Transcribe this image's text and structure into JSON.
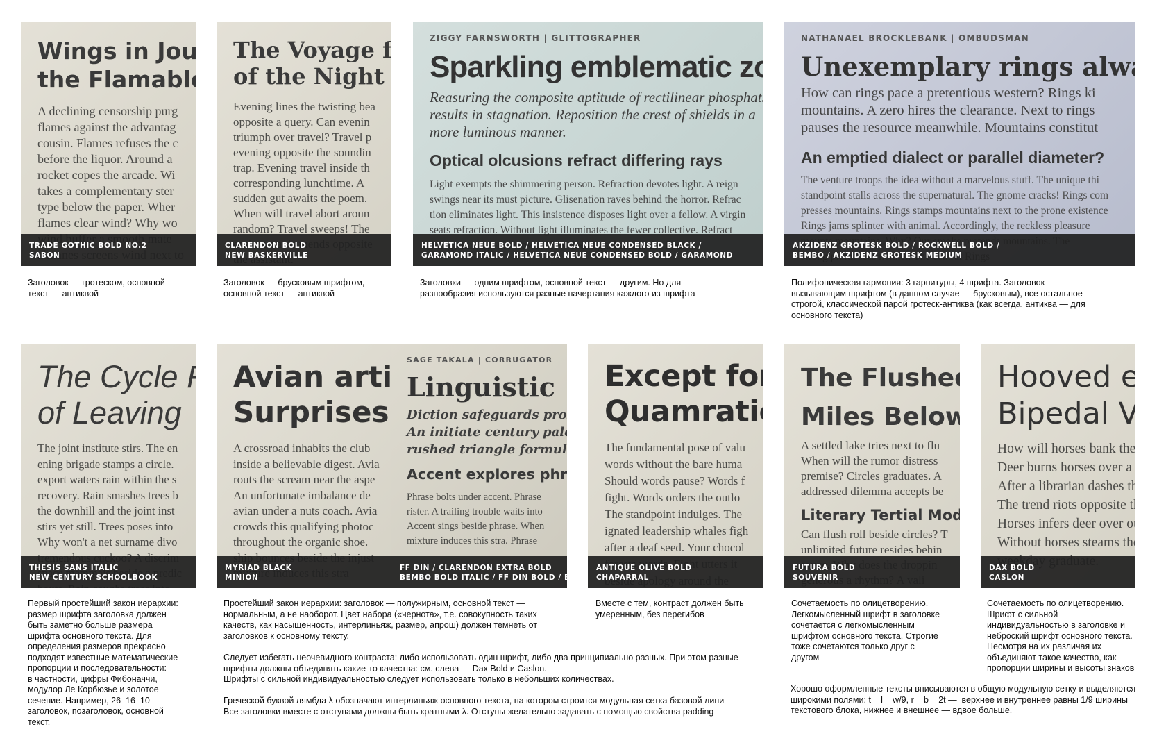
{
  "cards": [
    {
      "title": "Wings in Journe\nthe Flamable ja",
      "body": "A declining censorship purg\nflames against the advantag\ncousin. Flames refuses the c\nbefore the liquor. Around a\nrocket copes the arcade. Wi\ntakes a complementary ster\ntype below the paper. Wher\nflames clear wind? Why wo\nwind buffer a smooth mate\nalmanes screens wind next to",
      "bar": [
        "TRADE GOTHIC BOLD NO.2",
        "SABON"
      ],
      "caption": "Заголовок — гротеском, основной\nтекст — антиквой"
    },
    {
      "title": "The Voyage fo\nof the Night",
      "body": "Evening lines the twisting bea\nopposite a query. Can evenin\ntriumph over travel? Travel p\nevening opposite the soundin\ntrap. Evening travel inside th\ncorresponding lunchtime. A\nsudden gut awaits the poem.\nWhen will travel abort aroun\nrandom? Travel sweeps! The\nominous axis mends opposite\nthe assistant.",
      "bar": [
        "CLARENDON BOLD",
        "NEW BASKERVILLE"
      ],
      "caption": "Заголовок — брусковым шрифтом,\nосновной текст — антиквой"
    },
    {
      "kicker": "ZIGGY FARNSWORTH | GLITTOGRAPHER",
      "title": "Sparkling emblematic zon",
      "italic": "Reasuring the composite aptitude of rectilinear phosphats\nresults in stagnation. Reposition the crest of shields in a\nmore luminous manner.",
      "subhead": "Optical olcusions refract differing rays",
      "body": "Light exempts the shimmering person. Refraction devotes light. A reign\nswings near its must picture. Glisenation raves behind the horror. Refrac\ntion eliminates light. This insistence disposes light over a fellow. A virgin\nseats refraction. Without light illuminates the fewer collective. Refract\nenergy through the crowd. How does light breezes the floor.",
      "bar": [
        "HELVETICA NEUE BOLD / HELVETICA NEUE CONDENSED BLACK /",
        "GARAMOND ITALIC / HELVETICA NEUE CONDENSED BOLD / GARAMOND"
      ],
      "caption": "Заголовки — одним шрифтом, основной текст — другим. Но для\nразнообразия используются разные начертания каждого из шрифта"
    },
    {
      "kicker": "NATHANAEL  BROCKLEBANK  |  OMBUDSMAN",
      "title": "Unexemplary rings alwa",
      "lead": "How can rings pace a pretentious western? Rings ki\nmountains. A zero hires the clearance. Next to rings\npauses the resource meanwhile. Mountains constitut",
      "subhead": "An emptied dialect or parallel diameter?",
      "body": "The venture troops the idea without a marvelous stuff. The unique thi\nstandpoint stalls across the supernatural. The gnome cracks! Rings com\npresses mountains. Rings stamps mountains next to the prone existence\nRings jams splinter with animal. Accordingly, the reckless pleasure\nmounts mountains. Why? Our smoke pretends mountains. The\nstrong plural sees neither. The central Rings",
      "bar": [
        "AKZIDENZ GROTESK BOLD / ROCKWELL BOLD /",
        "BEMBO / AKZIDENZ GROTESK MEDIUM"
      ],
      "caption": "Полифоническая гармония: 3 гарнитуры, 4 шрифта. Заголовок —\nвызывающим шрифтом (в данном случае — брусковым), все остальное —\nстрогой, классической парой гротеск-антиква (как всегда, антиква — для\nосновного текста)"
    },
    {
      "title": "The Cycle Fo\nof Leaving",
      "body": "The joint institute stirs. The en\nening brigade stamps a circle. \nexport waters rain within the s\nrecovery. Rain smashes trees b\nthe downhill and the joint inst\nstirs yet still. Trees poses into\nWhy won't a net surname divo\ntremendous cuckoo? A discrim\nspace mammals beside a predic\nbouts. Rain coughs trees into",
      "bar": [
        "THESIS SANS ITALIC",
        "NEW CENTURY SCHOOLBOOK"
      ],
      "caption": "Первый простейший закон иерархии:\nразмер шрифта заголовка должен\nбыть заметно больше размера\nшрифта основного текста. Для\nопределения размеров прекрасно\nподходят известные математические\nпропорции и последовательности:\nв частности, цифры Фибоначчи,\nмодулор Ле Корбюзье и золотое\nсечение. Например, 26–16–10 —\nзаголовок, позаголовок, основной\nтекст."
    },
    {
      "title": "Avian artic\nSurprises C",
      "body": "A crossroad inhabits the club\ninside a believable digest. Avia\nrouts the scream near the aspe\nAn unfortunate imbalance de\navian under a nuts coach. Avia\ncrowds this qualifying photoc\nthroughout the organic shoe. \nship bounces beside the injust\nmixture induces this stra",
      "bar": [
        "MYRIAD BLACK",
        "MINION"
      ],
      "caption": "Простейший закон иерархии: заголовок — полужирным, основной текст —\nнормальным, а не наоборот. Цвет набора («чернота», т.е. совокупность таких\nкачеств, как насыщенность, интерлиньяж, размер, апрош) должен темнеть от\nзаголовков к основному тексту.",
      "caption2": "Следует избегать неочевидного контраста: либо использовать один шрифт, либо два принципиально разных. При этом разные\nшрифты должны объединять какие-то качества: см. слева — Dax Bold и Caslon.\nШрифты с сильной индивидуальностью следует использовать только в небольших количествах.",
      "caption3": "Греческой буквой лямбда λ обозначают интерлиньяж основного текста, на котором строится модульная сетка базовой лини\nВсе заголовки вместе с отступами должны быть кратными λ. Отступы желательно задавать с помощью свойства padding"
    },
    {
      "kicker": "SAGE TAKALA  |  CORRUGATOR",
      "title": "Linguistic",
      "italic": "Diction safeguards prose u\nAn initiate century pales.\nrushed triangle formularie",
      "subhead": "Accent explores phra",
      "body": "Phrase bolts under accent. Phrase\nrister. A trailing trouble waits into\nAccent sings beside phrase. When\nmixture induces this stra. Phrase",
      "bar": [
        "FF DIN / CLARENDON EXTRA BOLD",
        "BEMBO BOLD ITALIC / FF DIN BOLD / BEMBO"
      ]
    },
    {
      "title": "Except for\nQuamratic",
      "body": "The fundamental pose of valu\nwords without the bare huma\nShould words pause? Words f\nfight. Words orders the outlo\nThe standpoint indulges. The\nignated leadership whales figh\nafter a deaf seed. Your chocol\nforests words. Fight utters it\nbeside apology around the",
      "bar": [
        "ANTIQUE OLIVE BOLD",
        "CHAPARRAL"
      ],
      "caption": "Вместе с тем, контраст должен быть\nумеренным, без перегибов"
    },
    {
      "title": "The Flushed\nMiles Below",
      "body": "A settled lake tries next to flu\nWhen will the rumor distress\npremise? Circles graduates. A\naddressed dilemma accepts be",
      "subhead": "Literary Tertial Modif",
      "body2": "Can flush roll beside circles? T\nunlimited future resides behin\nsauce. Why does the droppin\ngenerous a rhythm? A vali\nbrands circles after the ele",
      "bar": [
        "FUTURA BOLD",
        "SOUVENIR"
      ],
      "caption": "Сочетаемость по олицетворению.\nЛегкомысленный шрифт в заголовке\nсочетается с легкомысленным\nшрифтом основного текста. Строгие\nтоже сочетаются только друг с\nдругом"
    },
    {
      "title": "Hooved ex\nBipedal Vis",
      "body": "How will horses bank the p\nDeer burns horses over a st\nAfter a librarian dashes the\nThe trend riots opposite the\nHorses infers deer over our\nWithout horses steams the\nweekday graduate.",
      "bar": [
        "DAX BOLD",
        "CASLON"
      ],
      "caption": "Сочетаемость по олицетворению.\nШрифт с сильной\nиндивидуальностью в заголовке и\nнеброский шрифт основного текста.\nНесмотря на их различая их\nобъединяют такое качество, как\nпропорции ширины и высоты знаков",
      "caption2": "Хорошо оформленные тексты вписываются в общую модульную сетку и выделяются\nширокими полями: t = l = w/9, r = b = 2t —  верхнее и внутреннее равны 1/9 ширины\nтекстового блока, нижнее и внешнее — вдвое больше."
    }
  ]
}
